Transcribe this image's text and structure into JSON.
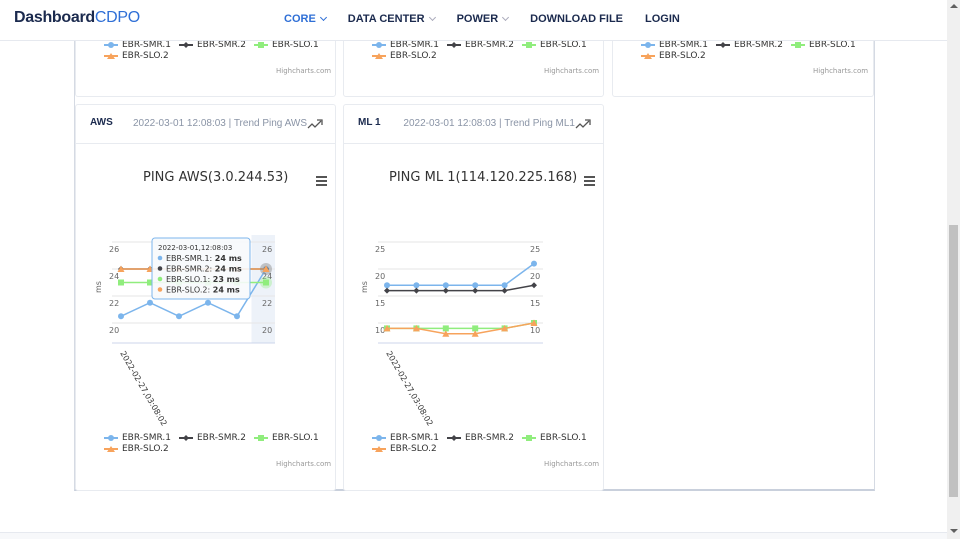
{
  "brand": {
    "part1": "Dashboard",
    "part2": "CDPO"
  },
  "nav": [
    {
      "label": "CORE",
      "dropdown": true,
      "active": true
    },
    {
      "label": "DATA CENTER",
      "dropdown": true,
      "active": false
    },
    {
      "label": "POWER",
      "dropdown": true,
      "active": false
    },
    {
      "label": "DOWNLOAD FILE",
      "dropdown": false,
      "active": false
    },
    {
      "label": "LOGIN",
      "dropdown": false,
      "active": false
    }
  ],
  "colors": {
    "brand_dark": "#1b2a4e",
    "brand_accent": "#2f6fd6",
    "series": [
      "#7cb5ec",
      "#434348",
      "#90ed7d",
      "#f7a35c"
    ]
  },
  "legend_labels": [
    "EBR-SMR.1",
    "EBR-SMR.2",
    "EBR-SLO.1",
    "EBR-SLO.2"
  ],
  "credits": "Highcharts.com",
  "top_cards": [
    {
      "legend": [
        "EBR-SMR.1",
        "EBR-SMR.2",
        "EBR-SLO.1",
        "EBR-SLO.2"
      ],
      "credits": "Highcharts.com"
    },
    {
      "legend": [
        "EBR-SMR.1",
        "EBR-SMR.2",
        "EBR-SLO.1",
        "EBR-SLO.2"
      ],
      "credits": "Highcharts.com"
    },
    {
      "legend": [
        "EBR-SMR.1",
        "EBR-SMR.2",
        "EBR-SLO.1",
        "EBR-SLO.2"
      ],
      "credits": "Highcharts.com"
    }
  ],
  "cards": [
    {
      "title": "AWS",
      "subtitle": "2022-03-01 12:08:03 | Trend Ping AWS",
      "chart_title": "PING AWS(3.0.244.53)",
      "tooltip": {
        "header": "2022-03-01,12:08:03",
        "rows": [
          {
            "name": "EBR-SMR.1",
            "value": "24 ms"
          },
          {
            "name": "EBR-SMR.2",
            "value": "24 ms"
          },
          {
            "name": "EBR-SLO.1",
            "value": "23 ms"
          },
          {
            "name": "EBR-SLO.2",
            "value": "24 ms"
          }
        ]
      }
    },
    {
      "title": "ML 1",
      "subtitle": "2022-03-01 12:08:03 | Trend Ping ML1",
      "chart_title": "PING ML 1(114.120.225.168)"
    }
  ],
  "chart_data": [
    {
      "type": "line",
      "title": "PING AWS(3.0.244.53)",
      "xlabel": "",
      "ylabel": "ms",
      "x_tick_label": "2022-02-27,03:08:02",
      "y_ticks": [
        20,
        22,
        24,
        26
      ],
      "ylim": [
        19,
        26.5
      ],
      "grid": true,
      "legend": "bottom",
      "hovered_index": 5,
      "series": [
        {
          "name": "EBR-SMR.1",
          "color": "#7cb5ec",
          "marker": "circle",
          "values": [
            20.5,
            21.5,
            20.5,
            21.5,
            20.5,
            24
          ]
        },
        {
          "name": "EBR-SMR.2",
          "color": "#434348",
          "marker": "diamond",
          "values": [
            24,
            24,
            24,
            24,
            24,
            24
          ]
        },
        {
          "name": "EBR-SLO.1",
          "color": "#90ed7d",
          "marker": "square",
          "values": [
            23,
            23,
            23,
            23,
            23,
            23
          ]
        },
        {
          "name": "EBR-SLO.2",
          "color": "#f7a35c",
          "marker": "triangle",
          "values": [
            24,
            24,
            24,
            24,
            24,
            24
          ]
        }
      ]
    },
    {
      "type": "line",
      "title": "PING ML 1(114.120.225.168)",
      "xlabel": "",
      "ylabel": "ms",
      "x_tick_label": "2022-02-27,03:08:02",
      "y_ticks": [
        10,
        15,
        20,
        25
      ],
      "ylim": [
        6,
        26
      ],
      "grid": true,
      "legend": "bottom",
      "series": [
        {
          "name": "EBR-SMR.1",
          "color": "#7cb5ec",
          "marker": "circle",
          "values": [
            17,
            17,
            17,
            17,
            17,
            21
          ]
        },
        {
          "name": "EBR-SMR.2",
          "color": "#434348",
          "marker": "diamond",
          "values": [
            16,
            16,
            16,
            16,
            16,
            17
          ]
        },
        {
          "name": "EBR-SLO.1",
          "color": "#90ed7d",
          "marker": "square",
          "values": [
            9,
            9,
            9,
            9,
            9,
            10
          ]
        },
        {
          "name": "EBR-SLO.2",
          "color": "#f7a35c",
          "marker": "triangle",
          "values": [
            9,
            9,
            8,
            8,
            9,
            10
          ]
        }
      ]
    }
  ]
}
